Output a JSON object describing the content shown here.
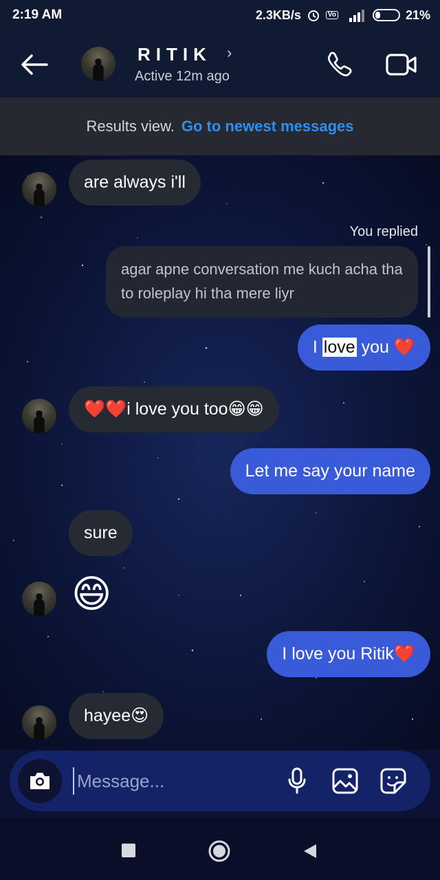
{
  "status_bar": {
    "time": "2:19 AM",
    "net_speed": "2.3KB/s",
    "network_type": "4G",
    "volte": "Vo LTE",
    "battery_percent": "21%"
  },
  "header": {
    "contact_name": "RITIK",
    "contact_status": "Active 12m ago"
  },
  "results_banner": {
    "text": "Results view.",
    "link": "Go to newest messages"
  },
  "messages": {
    "m1": "are always i'll",
    "reply_label": "You replied",
    "reply_quote": "agar apne conversation me kuch acha tha to roleplay hi tha mere liyr",
    "m2_pre": "I ",
    "m2_highlight": "love",
    "m2_post": " you ❤️",
    "m3": "❤️❤️i love you too😁😁",
    "m4": "Let me say your name",
    "m5": "sure",
    "m6_emoji": "😄",
    "m7": "I love you Ritik❤️",
    "m8": "hayee😍"
  },
  "composer": {
    "placeholder": "Message..."
  },
  "icons": {
    "back": "back-arrow-icon",
    "call": "phone-icon",
    "video": "video-camera-icon",
    "camera": "camera-icon",
    "mic": "microphone-icon",
    "gallery": "gallery-icon",
    "sticker": "sticker-icon"
  },
  "colors": {
    "outgoing_bubble": "#3a5bd9",
    "incoming_bubble": "#252a33",
    "link": "#2f8ff0",
    "header_bg": "#101a33"
  }
}
